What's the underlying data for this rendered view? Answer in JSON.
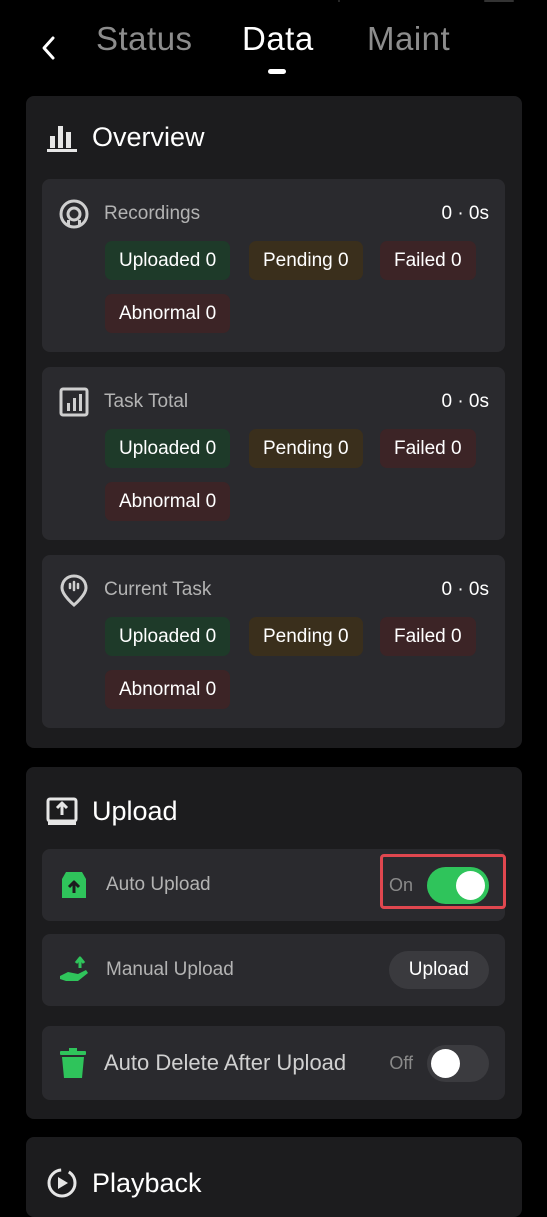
{
  "header": {
    "tabs": [
      {
        "label": "Status",
        "active": false
      },
      {
        "label": "Data",
        "active": true
      },
      {
        "label": "Maint",
        "active": false
      }
    ]
  },
  "overview": {
    "title": "Overview",
    "sections": [
      {
        "label": "Recordings",
        "value": "0 · 0s",
        "icon": "record-icon",
        "chips": {
          "uploaded": "Uploaded 0",
          "pending": "Pending 0",
          "failed": "Failed 0",
          "abnormal": "Abnormal 0"
        }
      },
      {
        "label": "Task Total",
        "value": "0 · 0s",
        "icon": "bar-chart-icon",
        "chips": {
          "uploaded": "Uploaded 0",
          "pending": "Pending 0",
          "failed": "Failed 0",
          "abnormal": "Abnormal 0"
        }
      },
      {
        "label": "Current Task",
        "value": "0 · 0s",
        "icon": "location-pin-icon",
        "chips": {
          "uploaded": "Uploaded 0",
          "pending": "Pending 0",
          "failed": "Failed 0",
          "abnormal": "Abnormal 0"
        }
      }
    ]
  },
  "upload": {
    "title": "Upload",
    "auto_upload": {
      "label": "Auto Upload",
      "state": "On",
      "enabled": true
    },
    "manual_upload": {
      "label": "Manual Upload",
      "button": "Upload"
    },
    "auto_delete": {
      "label": "Auto Delete After Upload",
      "state": "Off",
      "enabled": false
    }
  },
  "playback": {
    "title": "Playback"
  },
  "colors": {
    "background": "#000000",
    "card": "#1c1c1e",
    "panel": "#2a2a2e",
    "accent_green": "#2fc45b",
    "highlight": "#e0474f"
  }
}
